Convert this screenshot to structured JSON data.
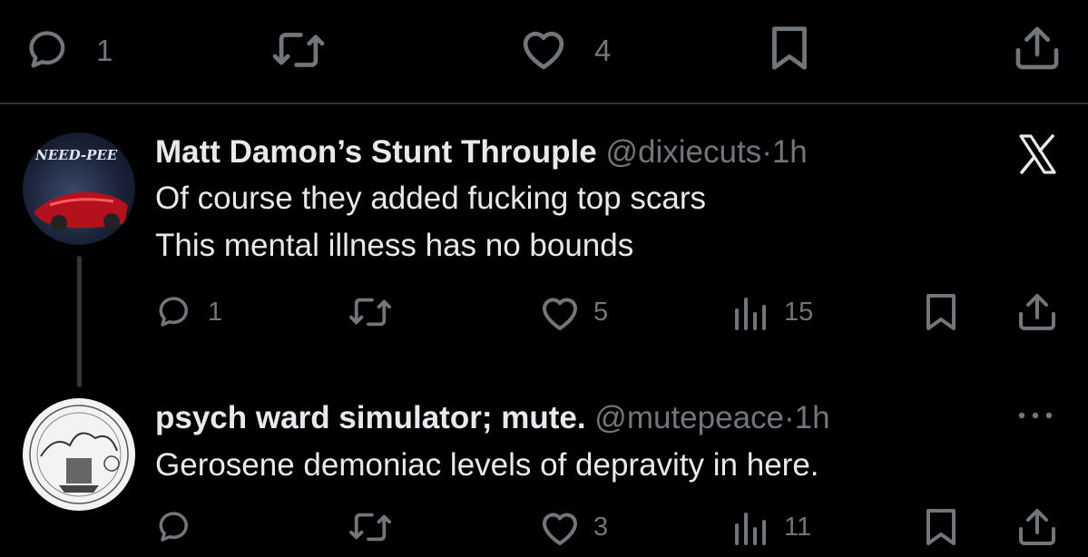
{
  "top_actions": {
    "reply_count": "1",
    "repost_count": "",
    "like_count": "4"
  },
  "post1": {
    "display_name": "Matt Damon’s Stunt Throuple",
    "handle": "@dixiecuts",
    "separator": "·",
    "time": "1h",
    "lines": [
      "Of course they added fucking top scars",
      "This mental illness has no bounds"
    ],
    "reply_count": "1",
    "like_count": "5",
    "view_count": "15",
    "avatar_text": "NEED-PEE",
    "brand_icon": "x-logo"
  },
  "post2": {
    "display_name": "psych ward simulator; mute.",
    "handle": "@mutepeace",
    "separator": "·",
    "time": "1h",
    "lines": [
      "Gerosene demoniac levels of depravity in here."
    ],
    "like_count": "3",
    "view_count": "11",
    "more_icon": "more-dots"
  },
  "colors": {
    "background": "#000000",
    "text_primary": "#e7e9ea",
    "text_secondary": "#71767b",
    "divider": "#2f3336"
  }
}
